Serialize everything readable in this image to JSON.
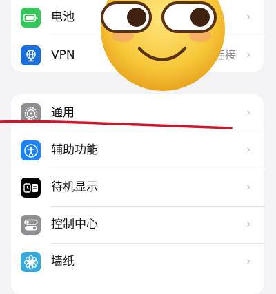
{
  "groups": [
    {
      "items": [
        {
          "label": "电池",
          "value": "",
          "icon": "battery-icon",
          "color": "#34c759"
        },
        {
          "label": "VPN",
          "value": "未连接",
          "icon": "globe-network-icon",
          "color": "#1a6fdc"
        }
      ]
    },
    {
      "items": [
        {
          "label": "通用",
          "value": "",
          "icon": "gear-icon",
          "color": "#8e8e93"
        },
        {
          "label": "辅助功能",
          "value": "",
          "icon": "accessibility-icon",
          "color": "#1a84ff"
        },
        {
          "label": "待机显示",
          "value": "",
          "icon": "standby-icon",
          "color": "#000000"
        },
        {
          "label": "控制中心",
          "value": "",
          "icon": "toggles-icon",
          "color": "#8e8e93"
        },
        {
          "label": "墙纸",
          "value": "",
          "icon": "flower-icon",
          "color": "#36aadf"
        }
      ]
    }
  ],
  "chevron": "›",
  "overlays": {
    "sticker": "smiling-emoji-sticker",
    "annotation": "red-strike-line"
  }
}
